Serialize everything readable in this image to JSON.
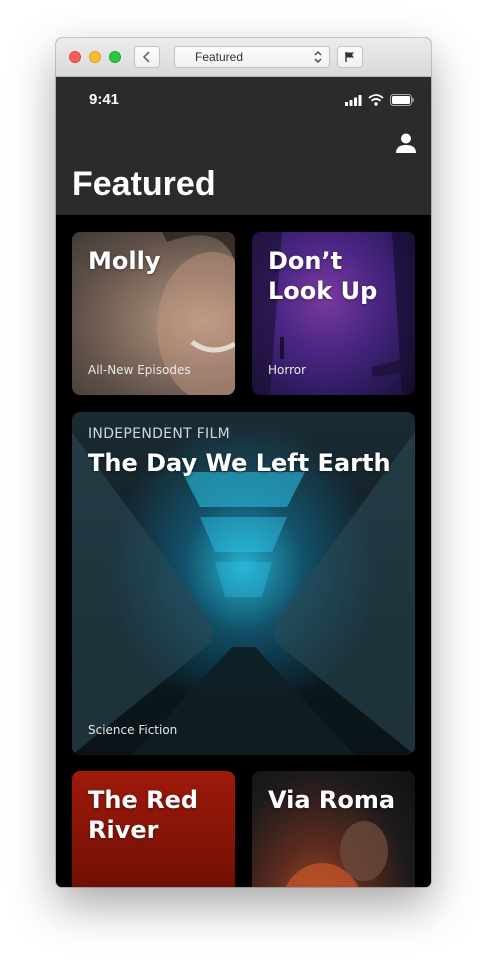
{
  "window": {
    "scheme_label": "Featured"
  },
  "status_bar": {
    "time": "9:41"
  },
  "nav": {
    "large_title": "Featured"
  },
  "cards": [
    {
      "title": "Molly",
      "subtitle": "All-New Episodes"
    },
    {
      "title": "Don’t\nLook Up",
      "subtitle": "Horror"
    },
    {
      "kicker": "INDEPENDENT FILM",
      "title": "The Day We Left Earth",
      "subtitle": "Science Fiction"
    },
    {
      "title": "The Red\nRiver"
    },
    {
      "title": "Via Roma"
    }
  ],
  "icons": {
    "back": "chevron-left-icon",
    "select": "updown-chevron-icon",
    "flag": "flag-icon",
    "signal": "cellular-signal-icon",
    "wifi": "wifi-icon",
    "battery": "battery-icon",
    "profile": "person-icon"
  }
}
